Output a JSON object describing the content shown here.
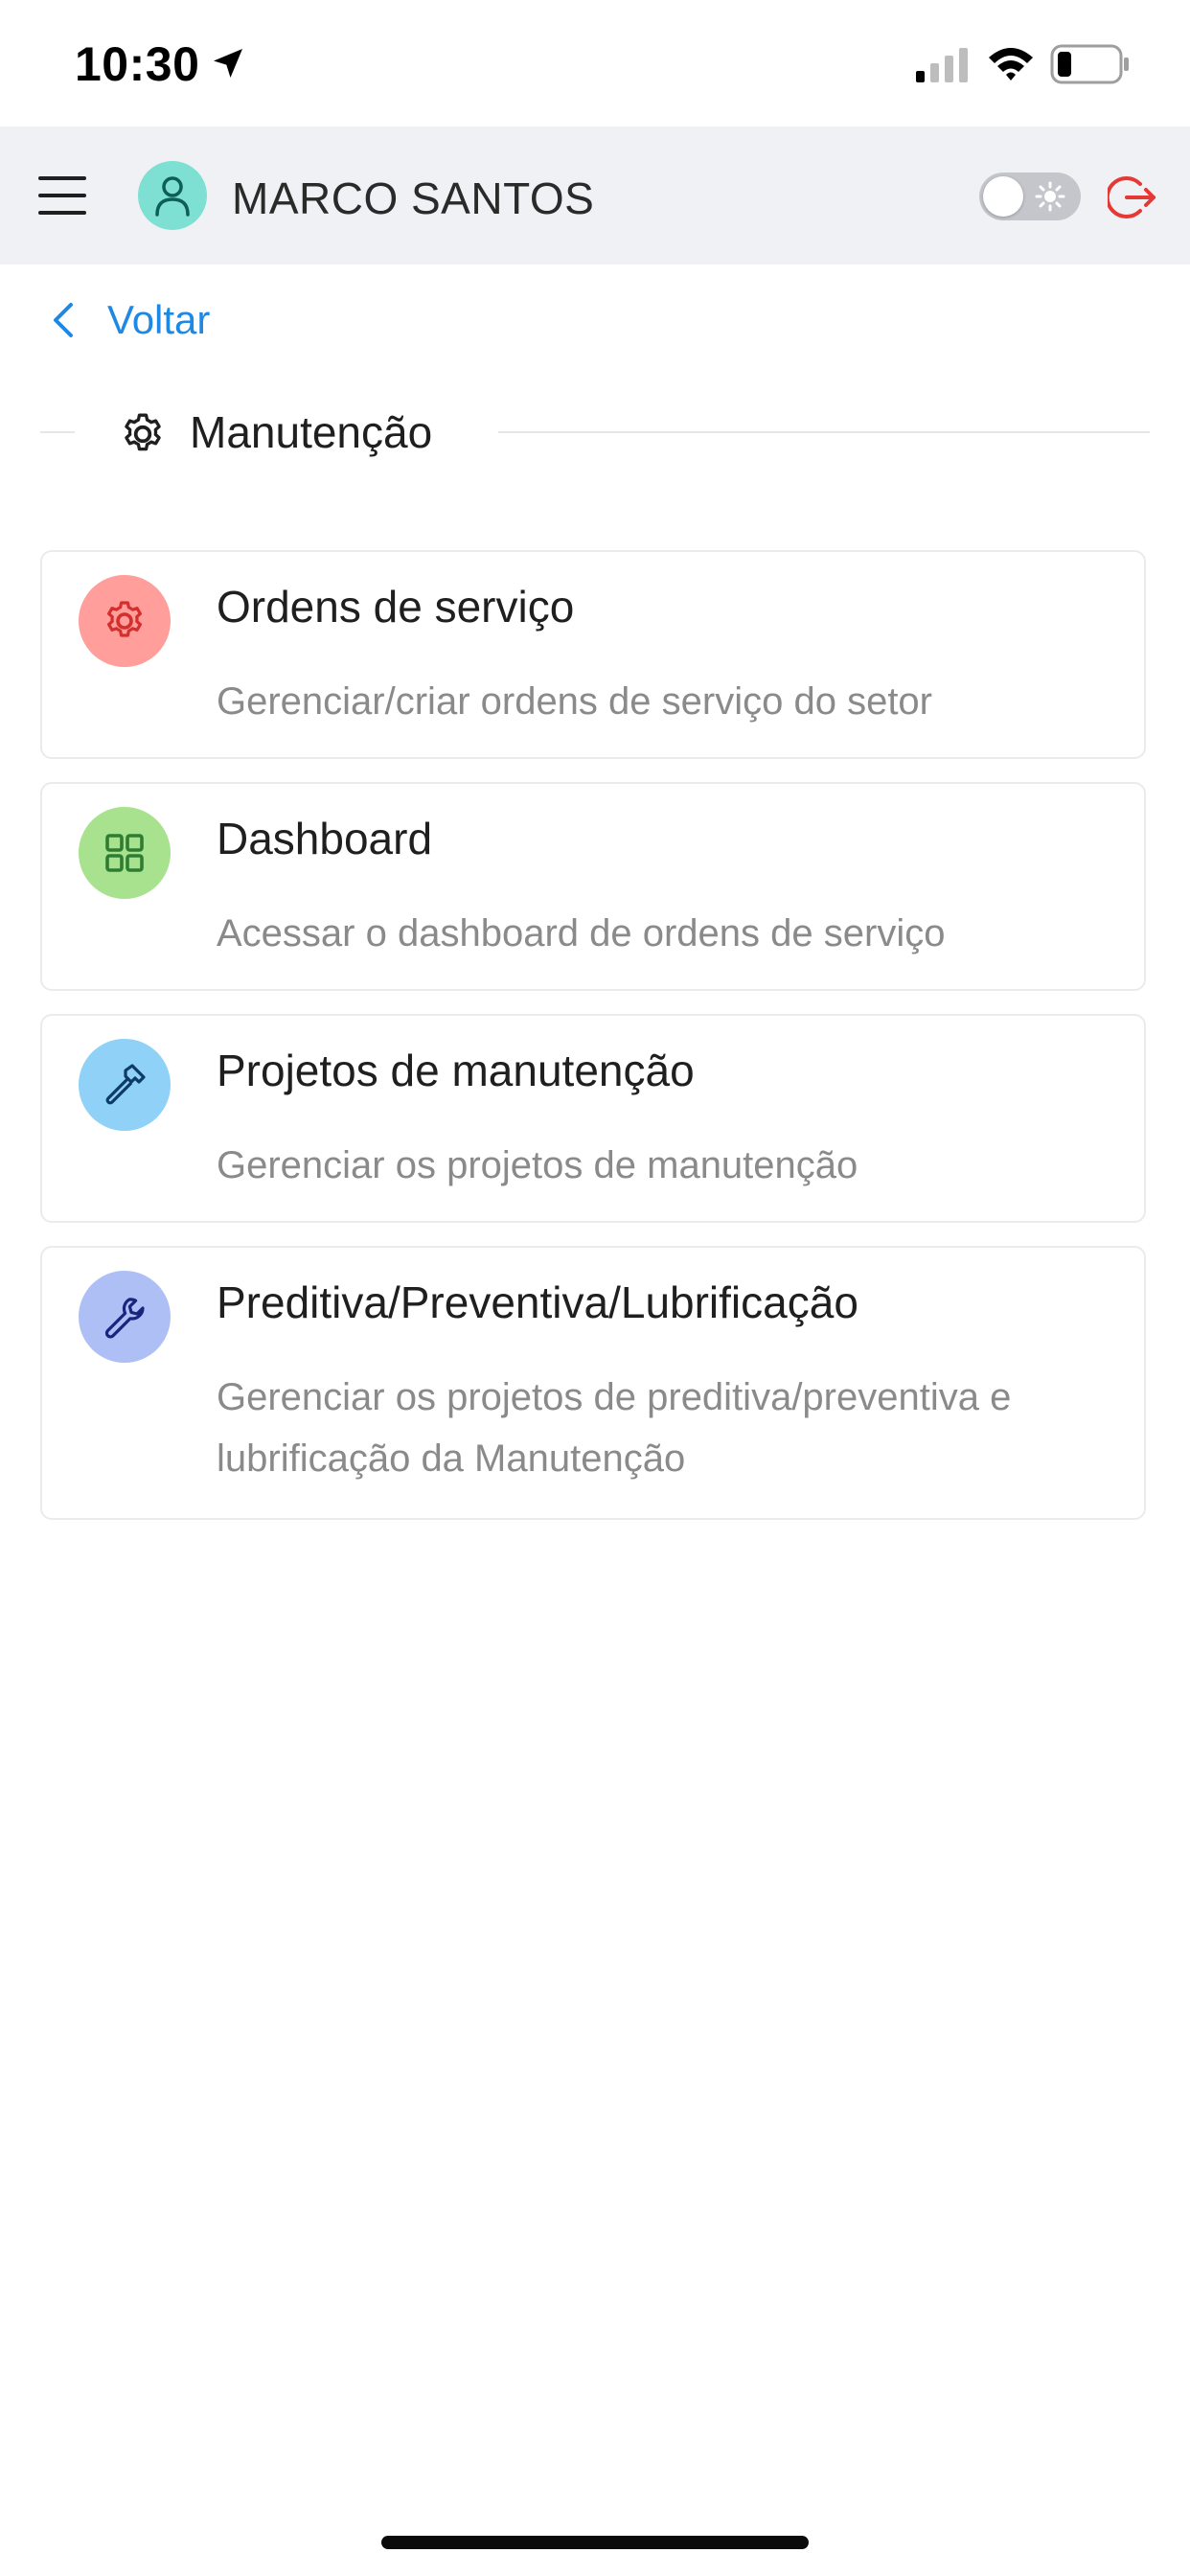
{
  "status_bar": {
    "time": "10:30",
    "icons": [
      "location-arrow-icon",
      "cellular-signal-icon",
      "wifi-icon",
      "battery-icon"
    ]
  },
  "header": {
    "user_name": "MARCO SANTOS",
    "avatar_color": "#7de0d3",
    "icons": [
      "hamburger-menu-icon",
      "user-icon",
      "sun-icon",
      "logout-icon"
    ],
    "theme_toggle_on": false,
    "logout_color": "#e53935"
  },
  "back": {
    "label": "Voltar",
    "color": "#1e88e5"
  },
  "section": {
    "title": "Manutenção",
    "icon": "gear-icon"
  },
  "cards": [
    {
      "title": "Ordens de serviço",
      "description": "Gerenciar/criar ordens de serviço do setor",
      "icon": "gear-icon",
      "icon_bg": "#ff9e9a",
      "icon_color": "#d32f2f"
    },
    {
      "title": "Dashboard",
      "description": "Acessar o dashboard de ordens de serviço",
      "icon": "grid-icon",
      "icon_bg": "#a8e28f",
      "icon_color": "#2e7d32"
    },
    {
      "title": "Projetos de manutenção",
      "description": "Gerenciar os projetos de manutenção",
      "icon": "hammer-icon",
      "icon_bg": "#8fd1f7",
      "icon_color": "#0d3b66"
    },
    {
      "title": "Preditiva/Preventiva/Lubrificação",
      "description": "Gerenciar os projetos de preditiva/preventiva e lubrificação da Manutenção",
      "icon": "wrench-icon",
      "icon_bg": "#aebff5",
      "icon_color": "#1a237e"
    }
  ]
}
